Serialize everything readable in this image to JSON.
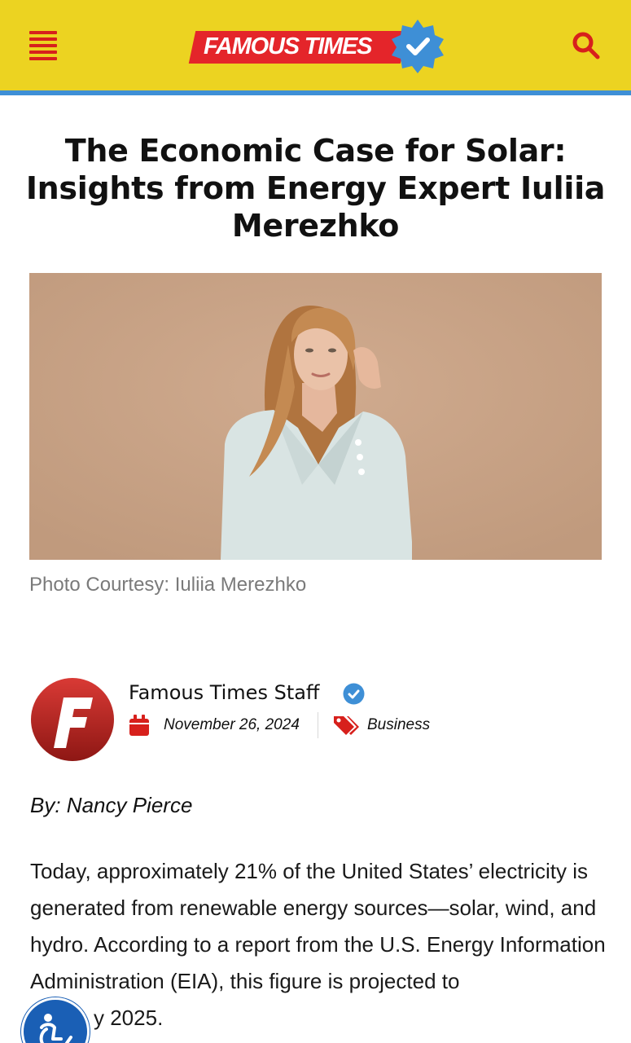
{
  "header": {
    "logo_text": "FAMOUS TIMES",
    "menu_icon": "hamburger-menu-icon",
    "search_icon": "search-icon",
    "badge_icon": "verified-badge-icon",
    "bar_color": "#ecd321",
    "accent_color": "#e4252a",
    "underline_color": "#3e8fd6"
  },
  "article": {
    "title": "The Economic Case for Solar: Insights from Energy Expert Iuliia Merezhko",
    "photo_caption": "Photo Courtesy: Iuliia Merezhko",
    "author_name": "Famous Times Staff",
    "date": "November 26, 2024",
    "category": "Business",
    "byline": "By: Nancy Pierce",
    "paragraph": "Today, approximately 21% of the United States’ electricity is generated from renewable energy sources—solar, wind, and hydro. According to a report from the U.S. Energy Information Administration (EIA), this figure is projected to",
    "paragraph_tail": "y 2025."
  },
  "icons": {
    "calendar": "calendar-icon",
    "tag": "tag-icon",
    "verified": "verified-check-icon",
    "accessibility": "accessibility-icon"
  }
}
